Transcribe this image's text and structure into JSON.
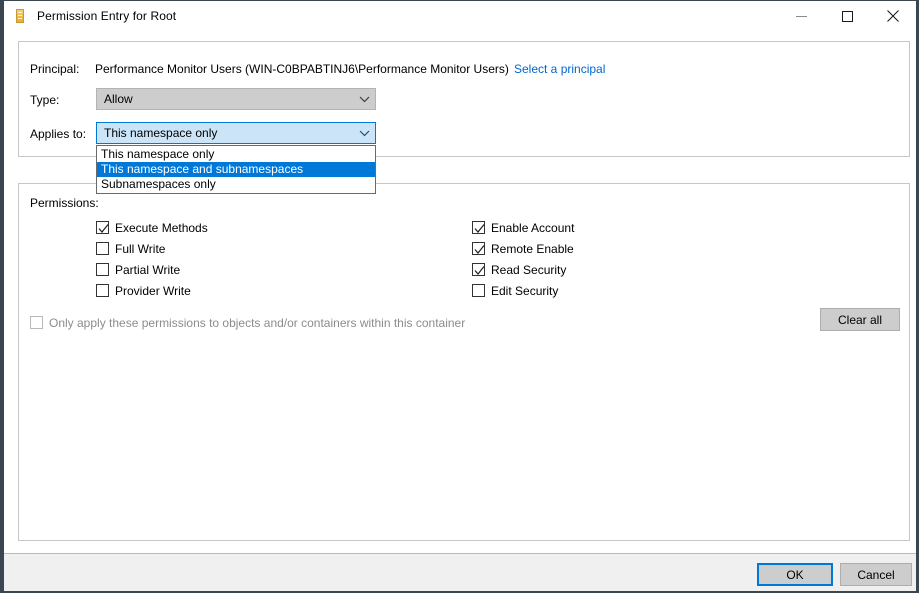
{
  "window": {
    "title": "Permission Entry for Root",
    "icon": "document-icon",
    "controls": {
      "minimize": "minimize-icon",
      "maximize": "maximize-icon",
      "close": "close-icon"
    }
  },
  "principal": {
    "label": "Principal:",
    "value": "Performance Monitor Users (WIN-C0BPABTINJ6\\Performance Monitor Users)",
    "link": "Select a principal"
  },
  "type": {
    "label": "Type:",
    "value": "Allow"
  },
  "applies_to": {
    "label": "Applies to:",
    "value": "This namespace only",
    "expanded": true,
    "options": [
      {
        "label": "This namespace only",
        "selected": false
      },
      {
        "label": "This namespace and subnamespaces",
        "selected": true
      },
      {
        "label": "Subnamespaces only",
        "selected": false
      }
    ]
  },
  "permissions": {
    "label": "Permissions:",
    "left_column": [
      {
        "label": "Execute Methods",
        "checked": true
      },
      {
        "label": "Full Write",
        "checked": false
      },
      {
        "label": "Partial Write",
        "checked": false
      },
      {
        "label": "Provider Write",
        "checked": false
      }
    ],
    "right_column": [
      {
        "label": "Enable Account",
        "checked": true
      },
      {
        "label": "Remote Enable",
        "checked": true
      },
      {
        "label": "Read Security",
        "checked": true
      },
      {
        "label": "Edit Security",
        "checked": false
      }
    ],
    "only_apply": {
      "label": "Only apply these permissions to objects and/or containers within this container",
      "checked": false,
      "disabled": true
    },
    "clear_all": "Clear all"
  },
  "footer": {
    "ok": "OK",
    "cancel": "Cancel"
  },
  "colors": {
    "accent": "#0078d7",
    "link": "#0066cc",
    "combo_focus_bg": "#cce4f7",
    "button_face": "#cdcdcd",
    "panel_border": "#c6c6c6",
    "window_border": "#3b4653"
  }
}
